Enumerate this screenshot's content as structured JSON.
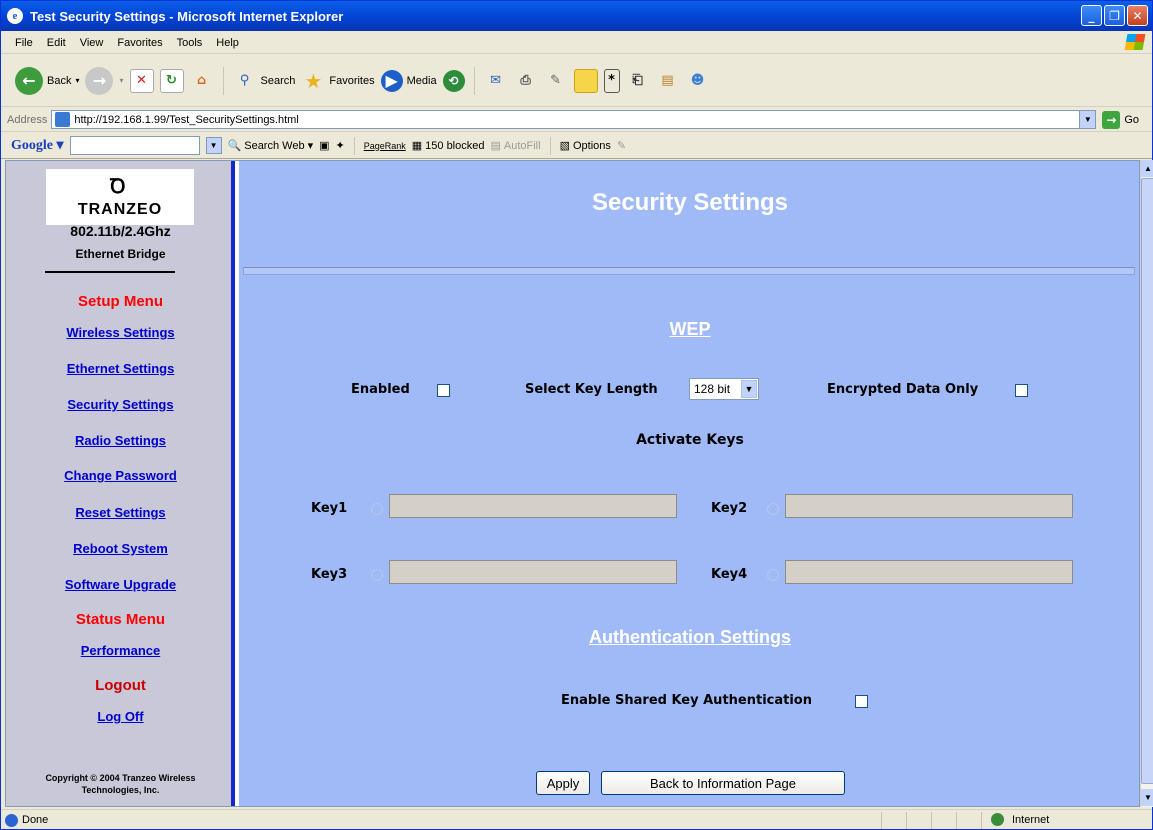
{
  "window": {
    "title": "Test Security Settings - Microsoft Internet Explorer"
  },
  "menubar": [
    "File",
    "Edit",
    "View",
    "Favorites",
    "Tools",
    "Help"
  ],
  "toolbar": {
    "back": "Back",
    "search": "Search",
    "favorites": "Favorites",
    "media": "Media"
  },
  "address": {
    "label": "Address",
    "url": "http://192.168.1.99/Test_SecuritySettings.html",
    "go": "Go"
  },
  "googlebar": {
    "logo": "Google",
    "search_web": "Search Web",
    "pagerank": "PageRank",
    "blocked": "150 blocked",
    "autofill": "AutoFill",
    "options": "Options"
  },
  "sidebar": {
    "brand": "TRANZEO",
    "model": "802.11b/2.4Ghz",
    "subtitle": "Ethernet Bridge",
    "setup_heading": "Setup Menu",
    "setup_items": [
      "Wireless Settings",
      "Ethernet Settings",
      "Security Settings",
      "Radio Settings",
      "Change Password",
      "Reset Settings",
      "Reboot System",
      "Software Upgrade"
    ],
    "status_heading": "Status Menu",
    "status_items": [
      "Performance"
    ],
    "logout_heading": "Logout",
    "logout_items": [
      "Log Off"
    ],
    "copyright_line1": "Copyright © 2004 Tranzeo Wireless",
    "copyright_line2": "Technologies, Inc."
  },
  "main": {
    "heading": "Security Settings",
    "wep_heading": "WEP",
    "enabled_label": "Enabled",
    "key_length_label": "Select Key Length",
    "key_length_value": "128 bit",
    "encrypted_only_label": "Encrypted Data Only",
    "activate_keys_label": "Activate Keys",
    "keys": [
      "Key1",
      "Key2",
      "Key3",
      "Key4"
    ],
    "auth_heading": "Authentication Settings",
    "shared_key_label": "Enable Shared Key Authentication",
    "apply_button": "Apply",
    "back_button": "Back to Information Page"
  },
  "statusbar": {
    "status": "Done",
    "zone": "Internet"
  }
}
